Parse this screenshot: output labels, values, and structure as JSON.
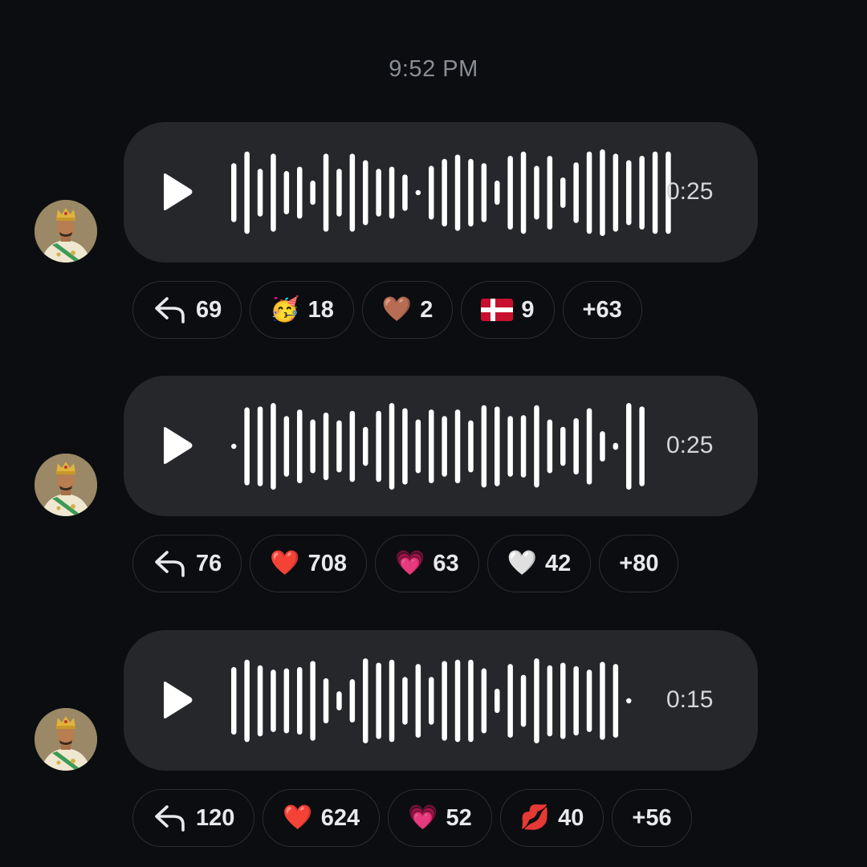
{
  "timestamp": "9:52 PM",
  "messages": [
    {
      "duration": "0:25",
      "waveform": [
        0.68,
        0.95,
        0.55,
        0.9,
        0.5,
        0.6,
        0.28,
        0.9,
        0.55,
        0.9,
        0.75,
        0.55,
        0.6,
        0.42,
        0.05,
        0.62,
        0.78,
        0.88,
        0.78,
        0.68,
        0.28,
        0.85,
        0.95,
        0.62,
        0.85,
        0.35,
        0.7,
        0.95,
        1.0,
        0.9,
        0.75,
        0.85,
        0.95,
        0.95
      ],
      "reactions": [
        {
          "icon": "reply-icon",
          "glyph": "",
          "count": "69"
        },
        {
          "icon": "partying-face-emoji",
          "glyph": "🥳",
          "count": "18"
        },
        {
          "icon": "brown-heart-emoji",
          "glyph": "🤎",
          "count": "2"
        },
        {
          "icon": "denmark-flag-emoji",
          "glyph": "",
          "count": "9"
        },
        {
          "icon": "more-reactions",
          "glyph": "",
          "count": "+63"
        }
      ]
    },
    {
      "duration": "0:25",
      "waveform": [
        0.05,
        0.9,
        0.92,
        1.0,
        0.7,
        0.85,
        0.62,
        0.78,
        0.6,
        0.82,
        0.45,
        0.82,
        1.0,
        0.88,
        0.62,
        0.85,
        0.7,
        0.85,
        0.6,
        0.95,
        0.92,
        0.7,
        0.72,
        0.95,
        0.62,
        0.45,
        0.65,
        0.88,
        0.35,
        0.08,
        1.0,
        0.92
      ],
      "reactions": [
        {
          "icon": "reply-icon",
          "glyph": "",
          "count": "76"
        },
        {
          "icon": "red-heart-emoji",
          "glyph": "❤️",
          "count": "708"
        },
        {
          "icon": "pink-heart-emoji",
          "glyph": "💗",
          "count": "63"
        },
        {
          "icon": "white-heart-emoji",
          "glyph": "🤍",
          "count": "42"
        },
        {
          "icon": "more-reactions",
          "glyph": "",
          "count": "+80"
        }
      ]
    },
    {
      "duration": "0:15",
      "waveform": [
        0.78,
        0.95,
        0.82,
        0.72,
        0.75,
        0.78,
        0.92,
        0.52,
        0.22,
        0.5,
        0.98,
        0.88,
        0.95,
        0.55,
        0.85,
        0.55,
        0.92,
        0.95,
        0.95,
        0.75,
        0.28,
        0.85,
        0.6,
        0.98,
        0.82,
        0.88,
        0.8,
        0.72,
        0.9,
        0.85,
        0.05
      ],
      "reactions": [
        {
          "icon": "reply-icon",
          "glyph": "",
          "count": "120"
        },
        {
          "icon": "red-heart-emoji",
          "glyph": "❤️",
          "count": "624"
        },
        {
          "icon": "pink-heart-emoji",
          "glyph": "💗",
          "count": "52"
        },
        {
          "icon": "kiss-mark-emoji",
          "glyph": "💋",
          "count": "40"
        },
        {
          "icon": "more-reactions",
          "glyph": "",
          "count": "+56"
        }
      ]
    }
  ]
}
